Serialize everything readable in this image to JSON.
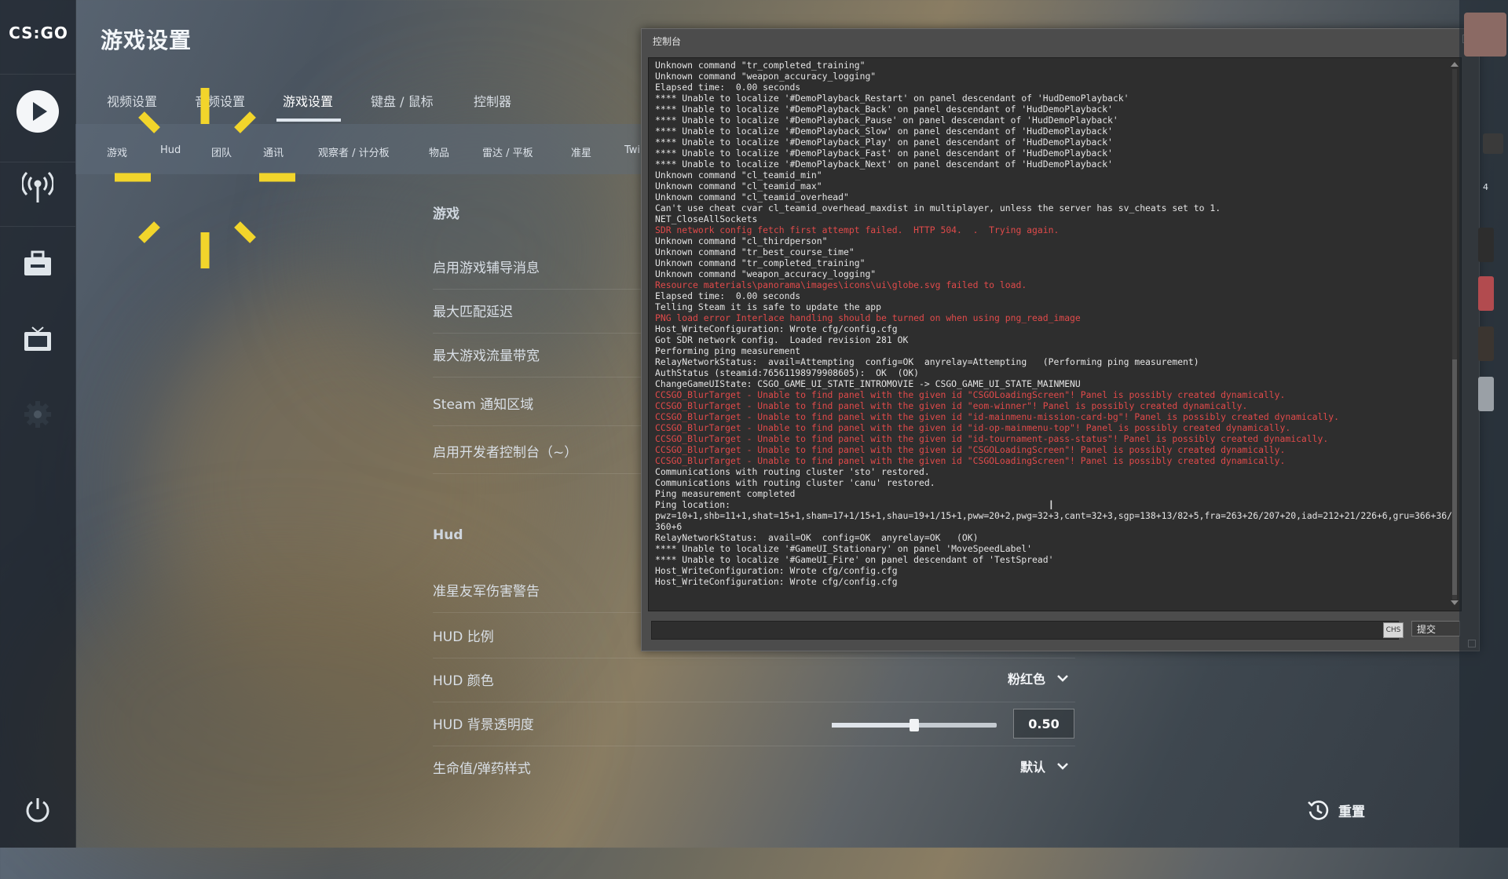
{
  "colors": {
    "accent_yellow": "#f2d52b",
    "console_error": "#e04a4a",
    "console_text": "#e4e4e4"
  },
  "app": {
    "logo": "CS:GO",
    "page_title": "游戏设置"
  },
  "sidebar": {
    "icons": [
      "play-icon",
      "broadcast-icon",
      "inventory-icon",
      "watch-tv-icon",
      "settings-gear-icon",
      "power-icon"
    ]
  },
  "tabs": [
    "视频设置",
    "音频设置",
    "游戏设置",
    "键盘 / 鼠标",
    "控制器"
  ],
  "active_tab": "游戏设置",
  "subtabs": [
    "游戏",
    "Hud",
    "团队",
    "通讯",
    "观察者 / 计分板",
    "物品",
    "雷达 / 平板",
    "准星",
    "Twi"
  ],
  "settings": {
    "section_game": "游戏",
    "game_rows": [
      "启用游戏辅导消息",
      "最大匹配延迟",
      "最大游戏流量带宽",
      "Steam 通知区域",
      "启用开发者控制台（~）"
    ],
    "section_hud": "Hud",
    "hud_rows": {
      "friendly_fire": "准星友军伤害警告",
      "hud_scale": "HUD 比例",
      "hud_color": {
        "label": "HUD 颜色",
        "value": "粉红色"
      },
      "hud_bg_opacity": {
        "label": "HUD 背景透明度",
        "value": "0.50",
        "slider_fraction": 0.5
      },
      "health_ammo": {
        "label": "生命值/弹药样式",
        "value": "默认"
      }
    }
  },
  "reset_label": "重置",
  "console": {
    "title": "控制台",
    "input_value": "",
    "ime_indicator": "CHS",
    "submit_label": "提交",
    "lines": [
      {
        "t": "Unknown command \"tr_completed_training\"",
        "e": false
      },
      {
        "t": "Unknown command \"weapon_accuracy_logging\"",
        "e": false
      },
      {
        "t": "Elapsed time:  0.00 seconds",
        "e": false
      },
      {
        "t": "**** Unable to localize '#DemoPlayback_Restart' on panel descendant of 'HudDemoPlayback'",
        "e": false
      },
      {
        "t": "**** Unable to localize '#DemoPlayback_Back' on panel descendant of 'HudDemoPlayback'",
        "e": false
      },
      {
        "t": "**** Unable to localize '#DemoPlayback_Pause' on panel descendant of 'HudDemoPlayback'",
        "e": false
      },
      {
        "t": "**** Unable to localize '#DemoPlayback_Slow' on panel descendant of 'HudDemoPlayback'",
        "e": false
      },
      {
        "t": "**** Unable to localize '#DemoPlayback_Play' on panel descendant of 'HudDemoPlayback'",
        "e": false
      },
      {
        "t": "**** Unable to localize '#DemoPlayback_Fast' on panel descendant of 'HudDemoPlayback'",
        "e": false
      },
      {
        "t": "**** Unable to localize '#DemoPlayback_Next' on panel descendant of 'HudDemoPlayback'",
        "e": false
      },
      {
        "t": "Unknown command \"cl_teamid_min\"",
        "e": false
      },
      {
        "t": "Unknown command \"cl_teamid_max\"",
        "e": false
      },
      {
        "t": "Unknown command \"cl_teamid_overhead\"",
        "e": false
      },
      {
        "t": "Can't use cheat cvar cl_teamid_overhead_maxdist in multiplayer, unless the server has sv_cheats set to 1.",
        "e": false
      },
      {
        "t": "NET_CloseAllSockets",
        "e": false
      },
      {
        "t": "SDR network config fetch first attempt failed.  HTTP 504.  .  Trying again.",
        "e": true
      },
      {
        "t": "Unknown command \"cl_thirdperson\"",
        "e": false
      },
      {
        "t": "Unknown command \"tr_best_course_time\"",
        "e": false
      },
      {
        "t": "Unknown command \"tr_completed_training\"",
        "e": false
      },
      {
        "t": "Unknown command \"weapon_accuracy_logging\"",
        "e": false
      },
      {
        "t": "Resource materials\\panorama\\images\\icons\\ui\\globe.svg failed to load.",
        "e": true
      },
      {
        "t": "Elapsed time:  0.00 seconds",
        "e": false
      },
      {
        "t": "Telling Steam it is safe to update the app",
        "e": false
      },
      {
        "t": "PNG load error Interlace handling should be turned on when using png_read_image",
        "e": true
      },
      {
        "t": "Host_WriteConfiguration: Wrote cfg/config.cfg",
        "e": false
      },
      {
        "t": "Got SDR network config.  Loaded revision 281 OK",
        "e": false
      },
      {
        "t": "Performing ping measurement",
        "e": false
      },
      {
        "t": "RelayNetworkStatus:  avail=Attempting  config=OK  anyrelay=Attempting   (Performing ping measurement)",
        "e": false
      },
      {
        "t": "AuthStatus (steamid:76561198979908605):  OK  (OK)",
        "e": false
      },
      {
        "t": "ChangeGameUIState: CSGO_GAME_UI_STATE_INTROMOVIE -> CSGO_GAME_UI_STATE_MAINMENU",
        "e": false
      },
      {
        "t": "CCSGO_BlurTarget - Unable to find panel with the given id \"CSGOLoadingScreen\"! Panel is possibly created dynamically.",
        "e": true
      },
      {
        "t": "CCSGO_BlurTarget - Unable to find panel with the given id \"eom-winner\"! Panel is possibly created dynamically.",
        "e": true
      },
      {
        "t": "CCSGO_BlurTarget - Unable to find panel with the given id \"id-mainmenu-mission-card-bg\"! Panel is possibly created dynamically.",
        "e": true
      },
      {
        "t": "CCSGO_BlurTarget - Unable to find panel with the given id \"id-op-mainmenu-top\"! Panel is possibly created dynamically.",
        "e": true
      },
      {
        "t": "CCSGO_BlurTarget - Unable to find panel with the given id \"id-tournament-pass-status\"! Panel is possibly created dynamically.",
        "e": true
      },
      {
        "t": "CCSGO_BlurTarget - Unable to find panel with the given id \"CSGOLoadingScreen\"! Panel is possibly created dynamically.",
        "e": true
      },
      {
        "t": "CCSGO_BlurTarget - Unable to find panel with the given id \"CSGOLoadingScreen\"! Panel is possibly created dynamically.",
        "e": true
      },
      {
        "t": "Communications with routing cluster 'sto' restored.",
        "e": false
      },
      {
        "t": "Communications with routing cluster 'canu' restored.",
        "e": false
      },
      {
        "t": "Ping measurement completed",
        "e": false
      },
      {
        "t": "Ping location:",
        "e": false
      },
      {
        "t": "pwz=10+1,shb=11+1,shat=15+1,sham=17+1/15+1,shau=19+1/15+1,pww=20+2,pwg=32+3,cant=32+3,sgp=138+13/82+5,fra=263+26/207+20,iad=212+21/226+6,gru=366+36/360+6",
        "e": false
      },
      {
        "t": "RelayNetworkStatus:  avail=OK  config=OK  anyrelay=OK   (OK)",
        "e": false
      },
      {
        "t": "**** Unable to localize '#GameUI_Stationary' on panel 'MoveSpeedLabel'",
        "e": false
      },
      {
        "t": "**** Unable to localize '#GameUI_Fire' on panel descendant of 'TestSpread'",
        "e": false
      },
      {
        "t": "Host_WriteConfiguration: Wrote cfg/config.cfg",
        "e": false
      },
      {
        "t": "Host_WriteConfiguration: Wrote cfg/config.cfg",
        "e": false
      }
    ]
  },
  "friends_panel": {
    "count_label": "4"
  }
}
